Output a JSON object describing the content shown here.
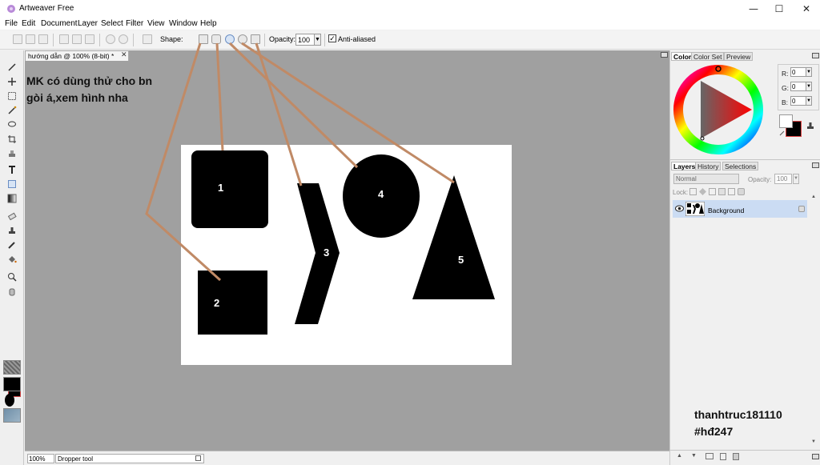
{
  "window": {
    "title": "Artweaver Free",
    "minimize": "—",
    "maximize": "☐",
    "close": "✕"
  },
  "menu": [
    "File",
    "Edit",
    "Document",
    "Layer",
    "Select",
    "Filter",
    "View",
    "Window",
    "Help"
  ],
  "toolbar": {
    "shape_label": "Shape:",
    "opacity_label": "Opacity:",
    "opacity_value": "100",
    "antialias_label": "Anti-aliased",
    "antialias_checked": true
  },
  "document": {
    "tab_title": "hướng dẫn @ 100% (8-bit) *"
  },
  "canvas": {
    "note_line1": "MK có dùng thử cho bn",
    "note_line2": "gòi á,xem hình nha",
    "shape_labels": [
      "1",
      "2",
      "3",
      "4",
      "5"
    ]
  },
  "status": {
    "zoom": "100%",
    "text": "Dropper tool"
  },
  "color_panel": {
    "tabs": [
      "Color",
      "Color Set",
      "Preview"
    ],
    "r_label": "R:",
    "r": "0",
    "g_label": "G:",
    "g": "0",
    "b_label": "B:",
    "b": "0"
  },
  "layers_panel": {
    "tabs": [
      "Layers",
      "History",
      "Selections"
    ],
    "blend_mode": "Normal",
    "opacity_label": "Opacity:",
    "opacity": "100",
    "lock_label": "Lock:",
    "layer_name": "Background"
  },
  "watermark": {
    "line1": "thanhtruc181110",
    "line2": "#hđ247"
  },
  "colors": {
    "accent_line": "#c08a66",
    "workspace": "#a0a0a0",
    "layer_selected": "#cbdcf3"
  }
}
